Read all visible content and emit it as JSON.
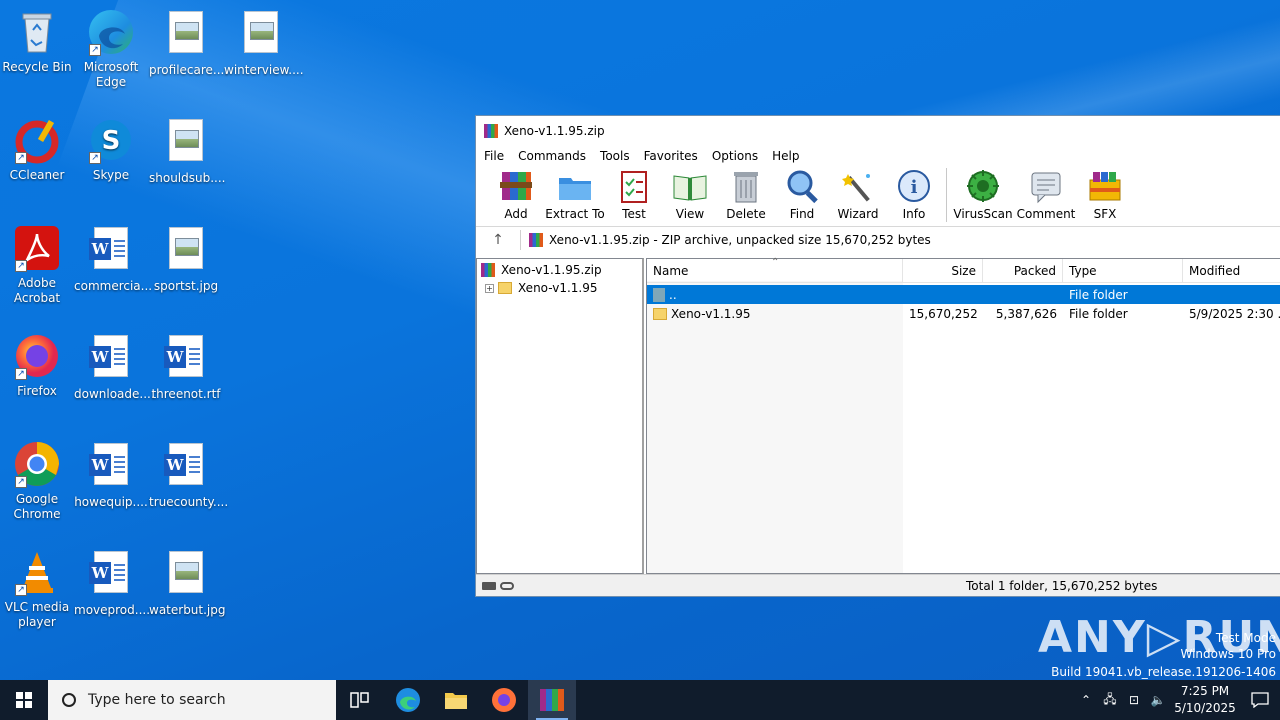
{
  "desktop": {
    "icons": [
      {
        "label": "Recycle Bin",
        "kind": "recycle-bin"
      },
      {
        "label": "Microsoft Edge",
        "kind": "edge"
      },
      {
        "label": "profilecare....",
        "kind": "image-file"
      },
      {
        "label": "winterview....",
        "kind": "image-file"
      },
      {
        "label": "CCleaner",
        "kind": "ccleaner"
      },
      {
        "label": "Skype",
        "kind": "skype"
      },
      {
        "label": "shouldsub....",
        "kind": "image-file"
      },
      {
        "label": "Adobe Acrobat",
        "kind": "acrobat"
      },
      {
        "label": "commercia...",
        "kind": "word-file"
      },
      {
        "label": "sportst.jpg",
        "kind": "image-file"
      },
      {
        "label": "Firefox",
        "kind": "firefox"
      },
      {
        "label": "downloade....",
        "kind": "word-file"
      },
      {
        "label": "threenot.rtf",
        "kind": "word-file"
      },
      {
        "label": "Google Chrome",
        "kind": "chrome"
      },
      {
        "label": "howequip....",
        "kind": "word-file"
      },
      {
        "label": "truecounty....",
        "kind": "word-file"
      },
      {
        "label": "VLC media player",
        "kind": "vlc"
      },
      {
        "label": "moveprod....",
        "kind": "word-file"
      },
      {
        "label": "waterbut.jpg",
        "kind": "image-file"
      }
    ]
  },
  "winrar": {
    "title": "Xeno-v1.1.95.zip",
    "menu": [
      "File",
      "Commands",
      "Tools",
      "Favorites",
      "Options",
      "Help"
    ],
    "toolbar": [
      "Add",
      "Extract To",
      "Test",
      "View",
      "Delete",
      "Find",
      "Wizard",
      "Info",
      "VirusScan",
      "Comment",
      "SFX"
    ],
    "address": "Xeno-v1.1.95.zip - ZIP archive, unpacked size 15,670,252 bytes",
    "tree": {
      "root": "Xeno-v1.1.95.zip",
      "child": "Xeno-v1.1.95"
    },
    "columns": {
      "name": "Name",
      "size": "Size",
      "packed": "Packed",
      "type": "Type",
      "modified": "Modified"
    },
    "rows": [
      {
        "name": "..",
        "size": "",
        "packed": "",
        "type": "File folder",
        "modified": ""
      },
      {
        "name": "Xeno-v1.1.95",
        "size": "15,670,252",
        "packed": "5,387,626",
        "type": "File folder",
        "modified": "5/9/2025 2:30 ..."
      }
    ],
    "status": "Total 1 folder, 15,670,252 bytes"
  },
  "taskbar": {
    "search_placeholder": "Type here to search",
    "time": "7:25 PM",
    "date": "5/10/2025"
  },
  "watermark": {
    "brand": "ANY RUN",
    "line1": "Test Mode",
    "line2": "Windows 10 Pro",
    "line3": "Build 19041.vb_release.191206-1406"
  }
}
